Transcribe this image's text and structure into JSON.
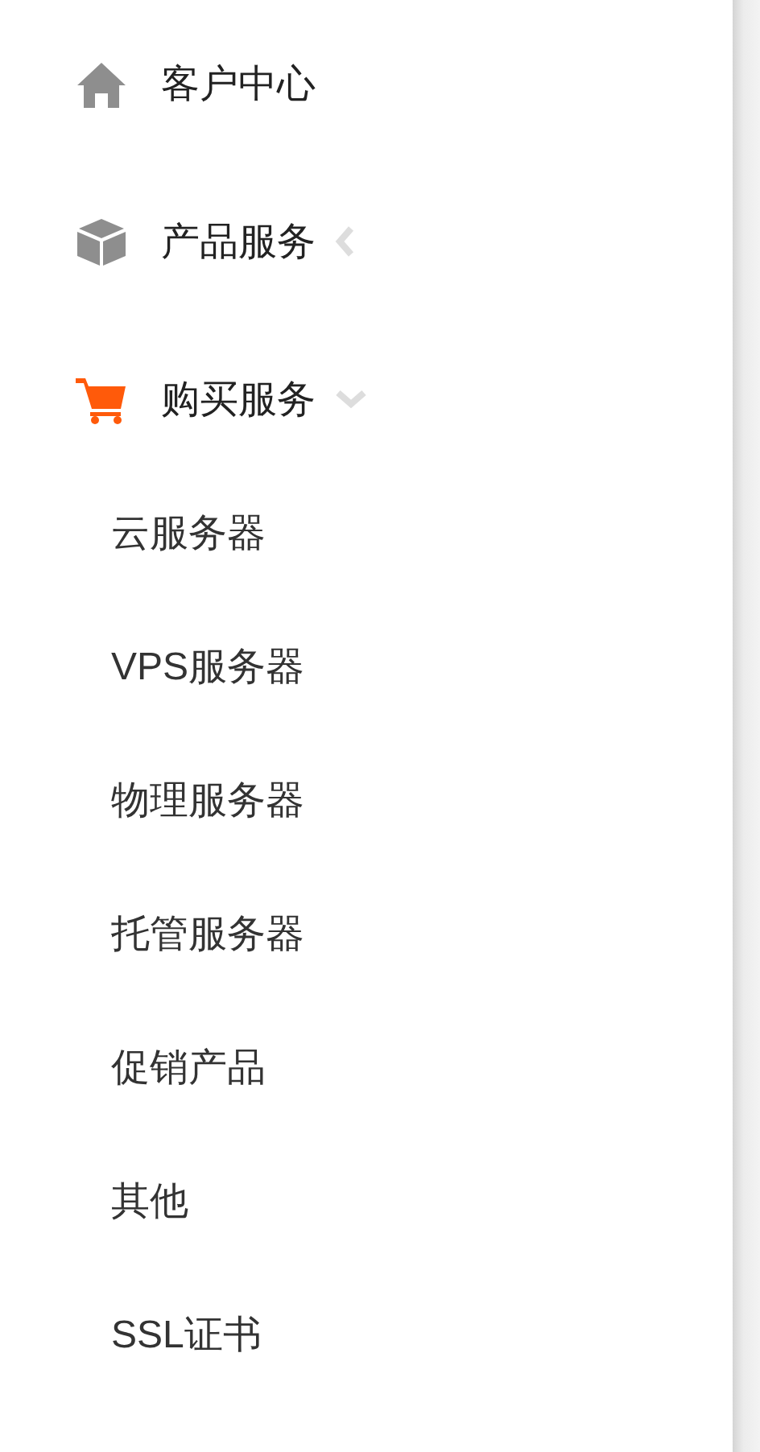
{
  "menu": [
    {
      "label": "客户中心",
      "kind": "link",
      "selected": false
    },
    {
      "label": "产品服务",
      "kind": "group",
      "selected": false,
      "expanded": false
    },
    {
      "label": "购买服务",
      "kind": "group",
      "selected": true,
      "expanded": true,
      "children": [
        {
          "label": "云服务器"
        },
        {
          "label": "VPS服务器"
        },
        {
          "label": "物理服务器"
        },
        {
          "label": "托管服务器"
        },
        {
          "label": "促销产品"
        },
        {
          "label": "其他"
        },
        {
          "label": "SSL证书"
        }
      ]
    }
  ]
}
